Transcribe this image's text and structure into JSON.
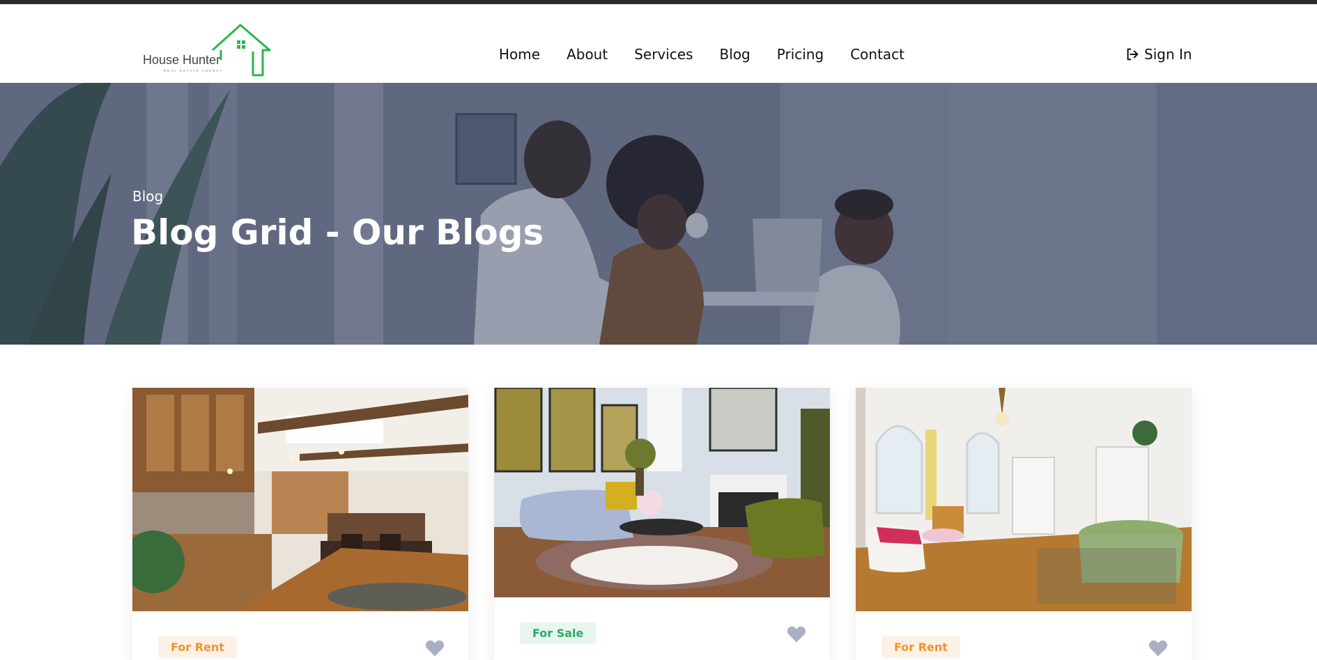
{
  "brand": {
    "name": "House Hunter",
    "tagline": "REAL ESTATE AGENCY",
    "color": "#2bb54f"
  },
  "nav": {
    "items": [
      {
        "label": "Home"
      },
      {
        "label": "About"
      },
      {
        "label": "Services"
      },
      {
        "label": "Blog"
      },
      {
        "label": "Pricing"
      },
      {
        "label": "Contact"
      }
    ],
    "signin_label": "Sign In",
    "signin_icon": "sign-in-icon"
  },
  "hero": {
    "breadcrumb": "Blog",
    "title": "Blog Grid - Our Blogs"
  },
  "cards": [
    {
      "badge": "For Rent",
      "badge_type": "rent",
      "image": "kitchen-photo",
      "favorite_icon": "heart-icon"
    },
    {
      "badge": "For Sale",
      "badge_type": "sale",
      "image": "living-room-photo",
      "favorite_icon": "heart-icon"
    },
    {
      "badge": "For Rent",
      "badge_type": "rent",
      "image": "dining-room-photo",
      "favorite_icon": "heart-icon"
    }
  ],
  "colors": {
    "rent_text": "#f0932b",
    "rent_bg": "#fdf1e6",
    "sale_text": "#2fa866",
    "sale_bg": "#e7f6ee",
    "heart": "#aab0c4"
  }
}
